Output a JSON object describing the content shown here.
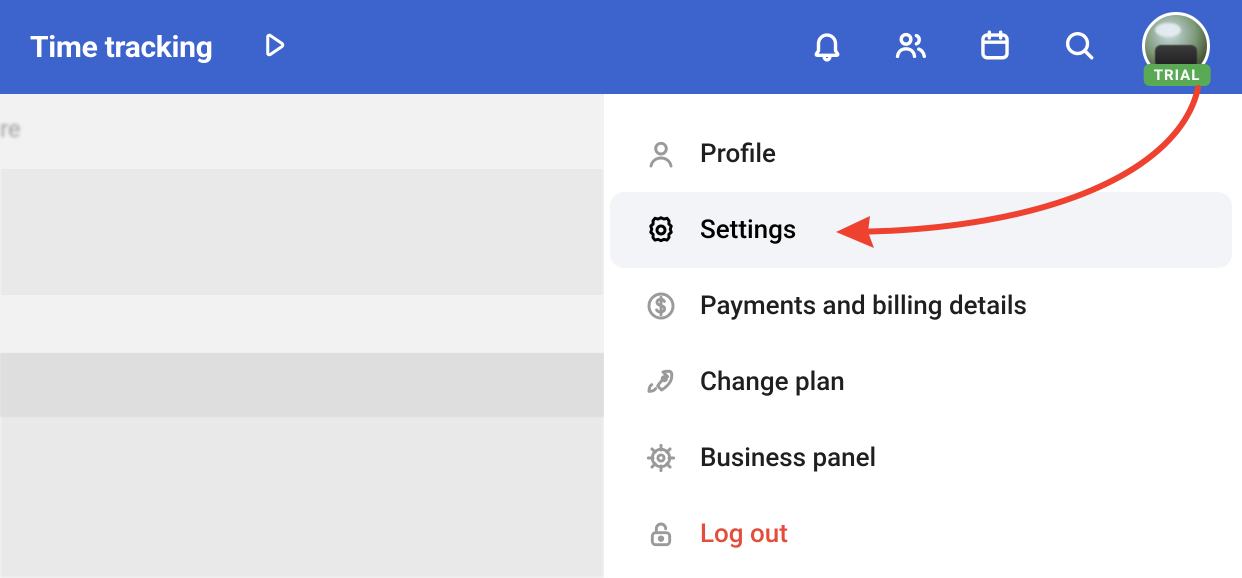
{
  "header": {
    "title": "Time tracking"
  },
  "avatar": {
    "badge": "TRIAL"
  },
  "menu": {
    "items": [
      {
        "label": "Profile"
      },
      {
        "label": "Settings"
      },
      {
        "label": "Payments and billing details"
      },
      {
        "label": "Change plan"
      },
      {
        "label": "Business panel"
      },
      {
        "label": "Log out"
      }
    ],
    "selected_index": 1
  }
}
